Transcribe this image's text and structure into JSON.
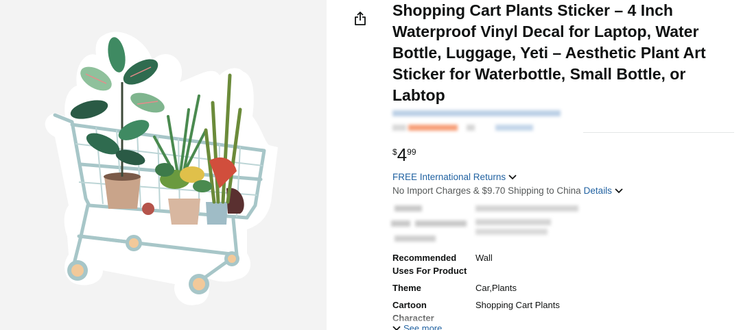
{
  "product": {
    "title": "Shopping Cart Plants Sticker – 4 Inch Waterproof Vinyl Decal for Laptop, Water Bottle, Luggage, Yeti – Aesthetic Plant Art Sticker for Waterbottle, Small Bottle, or Labtop",
    "image_alt": "Shopping cart filled with potted plants sticker"
  },
  "price": {
    "symbol": "$",
    "whole": "4",
    "fraction": "99"
  },
  "returns": {
    "label": "FREE International Returns"
  },
  "shipping": {
    "text": "No Import Charges & $9.70 Shipping to China",
    "details_label": "Details"
  },
  "specs": [
    {
      "label": "Recommended Uses For Product",
      "value": "Wall"
    },
    {
      "label": "Theme",
      "value": "Car,Plants"
    },
    {
      "label": "Cartoon Character",
      "value": "Shopping Cart Plants"
    }
  ],
  "see_more": {
    "label": "See more"
  },
  "colors": {
    "link": "#2162A1",
    "text": "#0F1111",
    "muted": "#565959",
    "rating_orange": "#F7A07A"
  },
  "icons": {
    "share": "share-icon",
    "chevron": "chevron-down-icon"
  }
}
